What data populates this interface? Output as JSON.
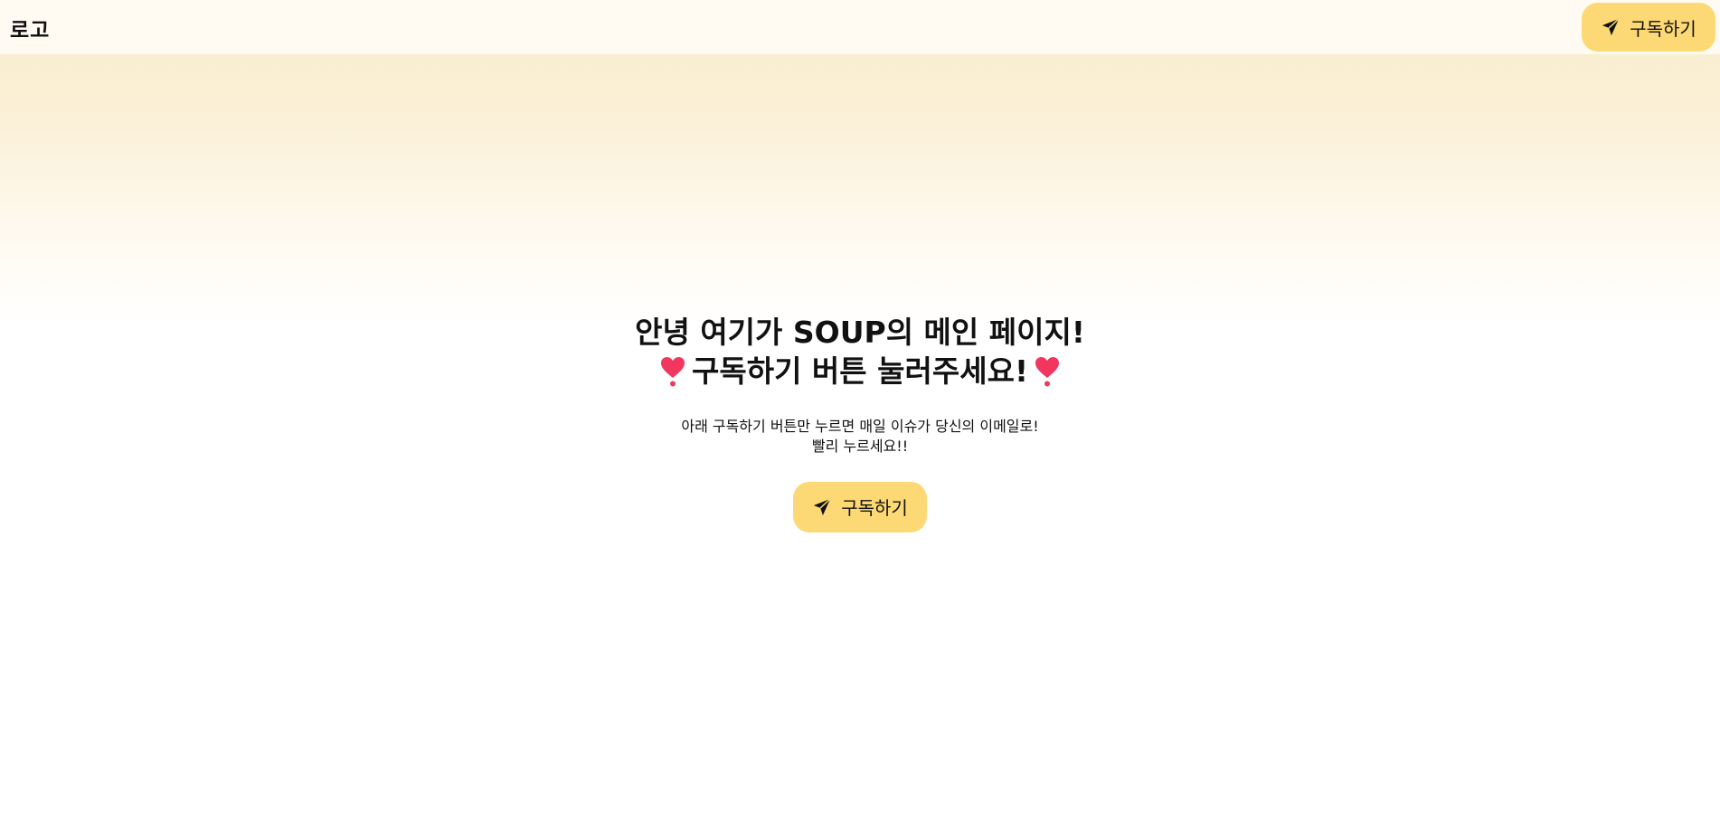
{
  "header": {
    "logo": "로고",
    "subscribe_label": "구독하기",
    "subscribe_icon": "send-icon"
  },
  "hero": {
    "headline_line1": "안녕 여기가 SOUP의 메인 페이지!",
    "headline_line2": "구독하기 버튼 눌러주세요!",
    "decoration_icon": "heart-exclamation-icon",
    "subtext_line1": "아래 구독하기 버튼만 누르면 매일 이슈가 당신의 이메일로!",
    "subtext_line2": "빨리 누르세요!!",
    "subscribe_label": "구독하기",
    "subscribe_icon": "send-icon"
  },
  "colors": {
    "button_bg": "#fcd974",
    "header_bg": "#fffaf2",
    "gradient_top": "#faeccb",
    "heart": "#f2375f"
  }
}
